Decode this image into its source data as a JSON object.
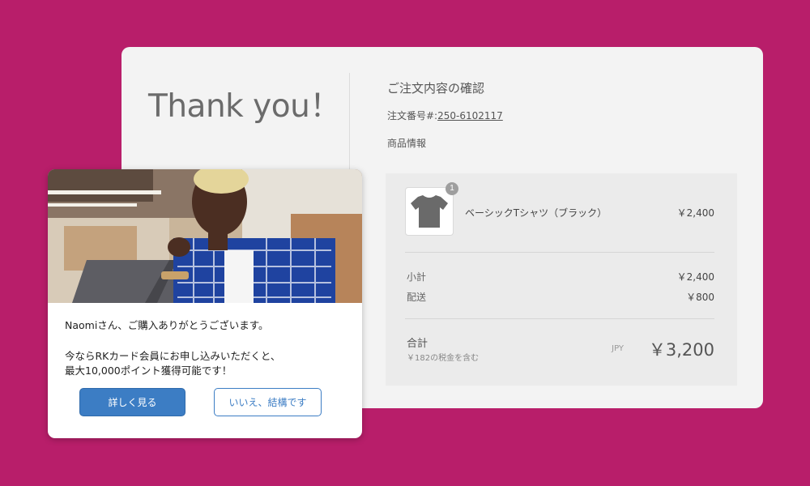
{
  "card": {
    "thanks": "Thank you！",
    "confirm_title": "ご注文内容の確認",
    "order_label": "注文番号#:",
    "order_number": "250-6102117",
    "product_info": "商品情報"
  },
  "summary": {
    "item": {
      "name": "ベーシックTシャツ（ブラック）",
      "price": "￥2,400",
      "qty": "1",
      "icon": "tshirt-icon"
    },
    "subtotal_label": "小計",
    "subtotal_value": "￥2,400",
    "shipping_label": "配送",
    "shipping_value": "￥800",
    "total_label": "合計",
    "tax_note": "￥182の税金を含む",
    "currency": "JPY",
    "total_value": "￥3,200"
  },
  "popup": {
    "greeting": "Naomiさん、ご購入ありがとうございます。",
    "offer_line1": "今ならRKカード会員にお申し込みいただくと、",
    "offer_line2": "最大10,000ポイント獲得可能です！",
    "primary_button": "詳しく見る",
    "secondary_button": "いいえ、結構です"
  },
  "colors": {
    "background": "#b81e6a",
    "primary": "#3c7dc4",
    "card": "#f3f3f3"
  }
}
